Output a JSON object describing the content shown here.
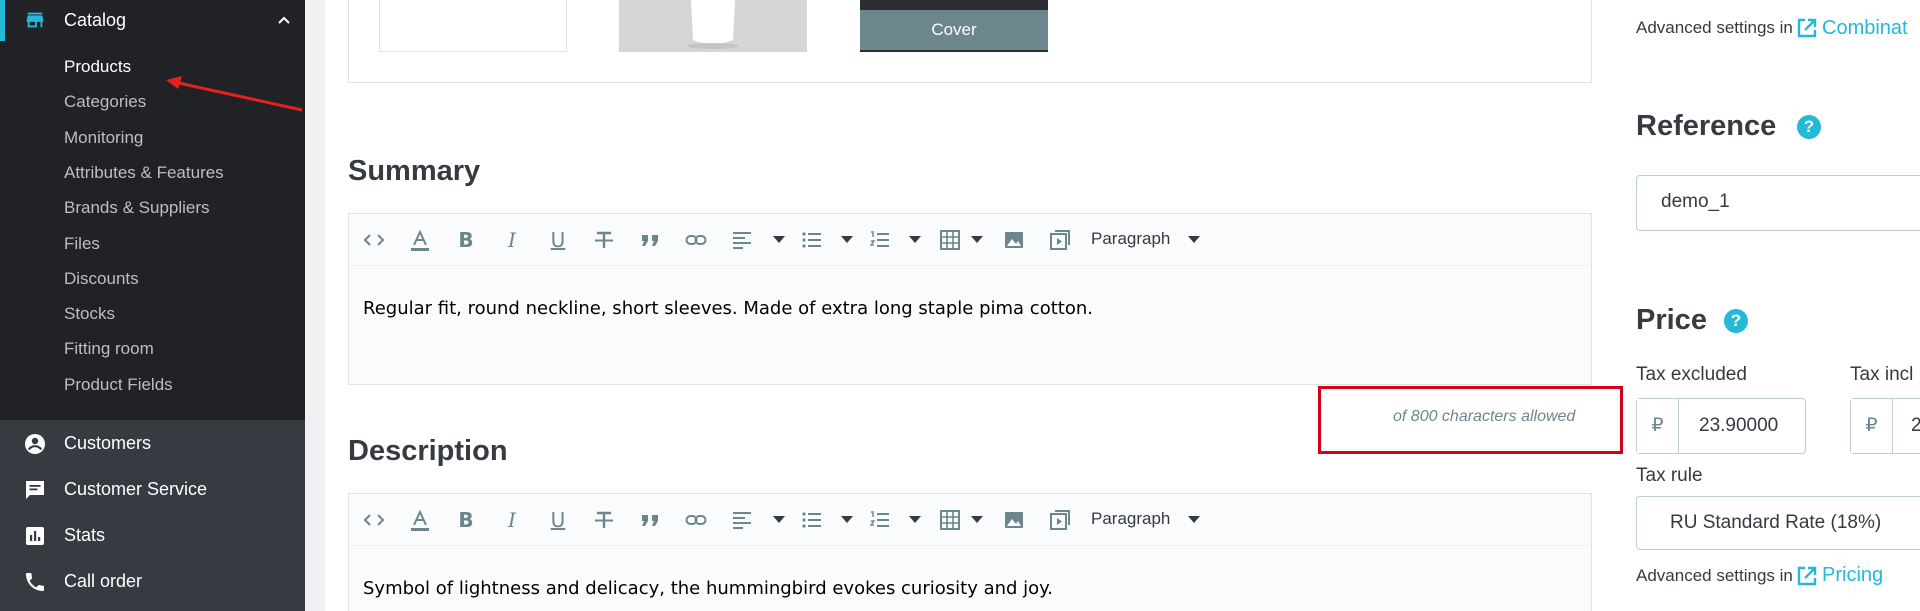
{
  "sidebar": {
    "catalog_label": "Catalog",
    "sub_items": [
      {
        "label": "Products",
        "active": true
      },
      {
        "label": "Categories"
      },
      {
        "label": "Monitoring"
      },
      {
        "label": "Attributes & Features"
      },
      {
        "label": "Brands & Suppliers"
      },
      {
        "label": "Files"
      },
      {
        "label": "Discounts"
      },
      {
        "label": "Stocks"
      },
      {
        "label": "Fitting room"
      },
      {
        "label": "Product Fields"
      }
    ],
    "main_items": [
      {
        "label": "Customers",
        "icon": "person-circle-icon"
      },
      {
        "label": "Customer Service",
        "icon": "chat-icon"
      },
      {
        "label": "Stats",
        "icon": "bar-chart-icon"
      },
      {
        "label": "Call order",
        "icon": "phone-icon"
      }
    ]
  },
  "images": {
    "cover_label": "Cover"
  },
  "summary": {
    "title": "Summary",
    "toolbar_format": "Paragraph",
    "text": "Regular fit, round neckline, short sleeves. Made of extra long staple pima cotton.",
    "counter": "of 800 characters allowed"
  },
  "description": {
    "title": "Description",
    "toolbar_format": "Paragraph",
    "text": "Symbol of lightness and delicacy, the hummingbird evokes curiosity and joy."
  },
  "right": {
    "advanced_prefix": "Advanced settings in",
    "combinations_link": "Combinat",
    "reference_title": "Reference",
    "reference_value": "demo_1",
    "price_title": "Price",
    "tax_excluded_label": "Tax excluded",
    "tax_included_label": "Tax incl",
    "currency_symbol": "₽",
    "tax_excluded_value": "23.90000",
    "tax_included_value": "2",
    "tax_rule_label": "Tax rule",
    "tax_rule_value": "RU Standard Rate (18%)",
    "pricing_link": "Pricing"
  },
  "colors": {
    "accent": "#25b9d7",
    "sidebar_bg": "#363a41",
    "submenu_bg": "#202226",
    "highlight_red": "#d0021b",
    "arrow_red": "#e3211e"
  }
}
